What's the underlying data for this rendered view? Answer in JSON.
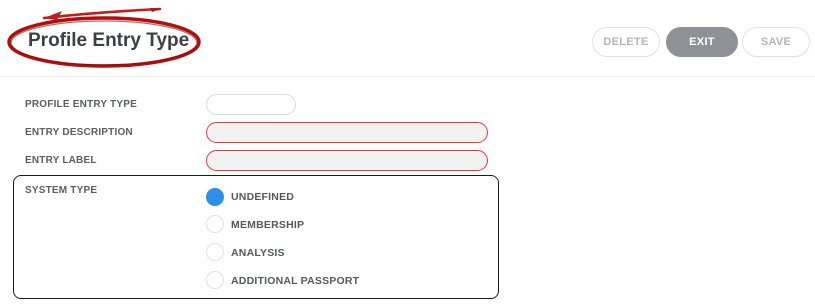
{
  "header": {
    "title": "Profile Entry Type",
    "buttons": {
      "delete": "DELETE",
      "exit": "EXIT",
      "save": "SAVE"
    }
  },
  "form": {
    "profile_entry_type": {
      "label": "PROFILE ENTRY TYPE",
      "value": ""
    },
    "entry_description": {
      "label": "ENTRY DESCRIPTION",
      "value": ""
    },
    "entry_label": {
      "label": "ENTRY LABEL",
      "value": ""
    },
    "system_type": {
      "label": "SYSTEM TYPE",
      "selected": "UNDEFINED",
      "options": [
        "UNDEFINED",
        "MEMBERSHIP",
        "ANALYSIS",
        "ADDITIONAL PASSPORT"
      ]
    }
  },
  "colors": {
    "annotation_red": "#b10f0f",
    "error_border": "#e23a3a",
    "radio_selected": "#2f8fe6",
    "exit_button": "#8e9296"
  },
  "icons": {
    "annotation": "red-ellipse-with-arrow"
  }
}
